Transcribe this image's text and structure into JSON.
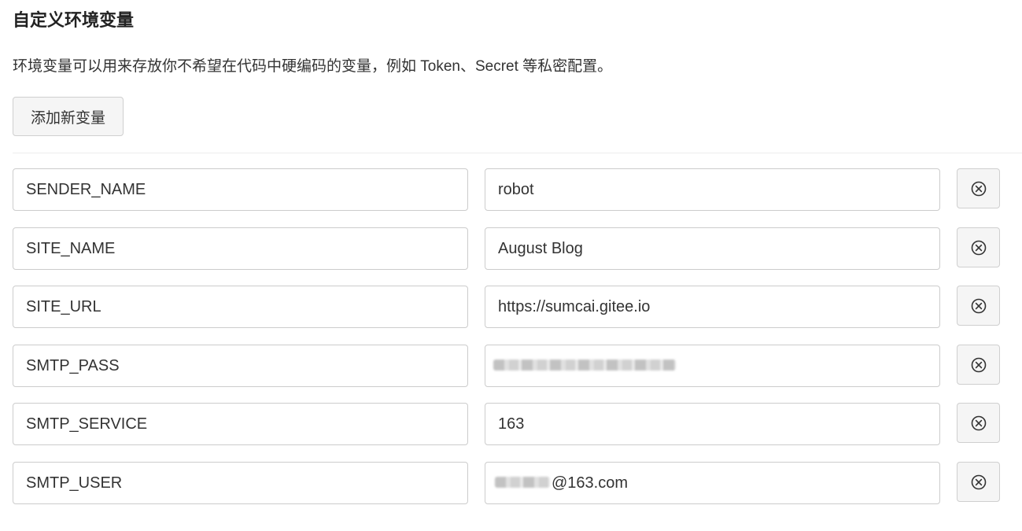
{
  "page": {
    "title": "自定义环境变量",
    "description": "环境变量可以用来存放你不希望在代码中硬编码的变量，例如 Token、Secret 等私密配置。",
    "add_button_label": "添加新变量"
  },
  "variables": [
    {
      "name": "SENDER_NAME",
      "value": "robot"
    },
    {
      "name": "SITE_NAME",
      "value": "August Blog"
    },
    {
      "name": "SITE_URL",
      "value": "https://sumcai.gitee.io"
    },
    {
      "name": "SMTP_PASS",
      "value": ""
    },
    {
      "name": "SMTP_SERVICE",
      "value": "163"
    },
    {
      "name": "SMTP_USER",
      "value_visible_suffix": "@163.com"
    }
  ],
  "icons": {
    "delete": "close-circle-icon"
  },
  "colors": {
    "border": "#cccccc",
    "button_bg": "#f5f5f5",
    "text": "#333333"
  }
}
